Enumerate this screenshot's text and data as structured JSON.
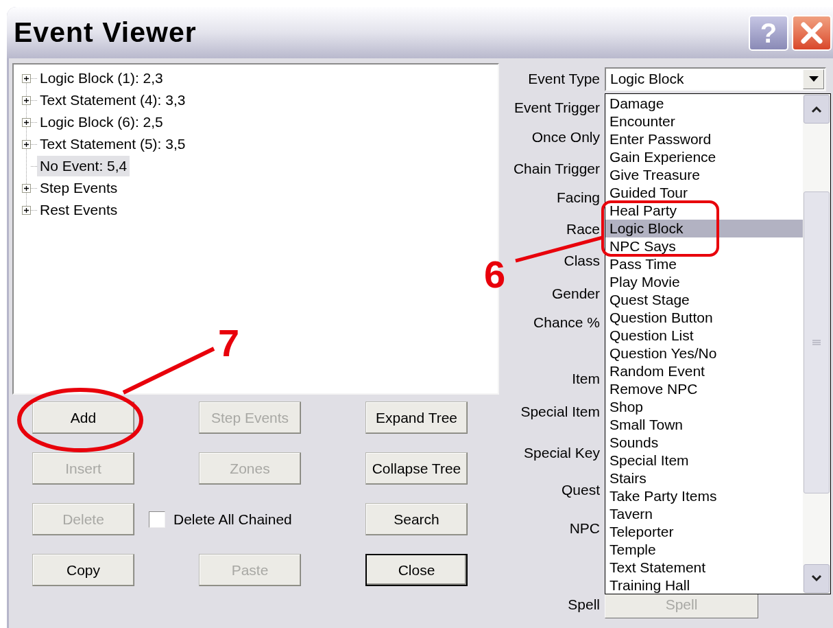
{
  "window": {
    "title": "Event Viewer"
  },
  "title_buttons": [
    {
      "kind": "help",
      "label": "?"
    },
    {
      "kind": "close"
    }
  ],
  "tree": [
    {
      "label": "Logic Block (1): 2,3",
      "expandable": true,
      "selected": false
    },
    {
      "label": "Text Statement (4): 3,3",
      "expandable": true,
      "selected": false
    },
    {
      "label": "Logic Block (6): 2,5",
      "expandable": true,
      "selected": false
    },
    {
      "label": "Text Statement (5): 3,5",
      "expandable": true,
      "selected": false
    },
    {
      "label": "No Event: 5,4",
      "expandable": false,
      "selected": true
    },
    {
      "label": "Step Events",
      "expandable": true,
      "selected": false
    },
    {
      "label": "Rest Events",
      "expandable": true,
      "selected": false
    }
  ],
  "controls": [
    {
      "kind": "button",
      "label": "Add",
      "disabled": false,
      "default": false
    },
    {
      "kind": "button",
      "label": "Step Events",
      "disabled": true,
      "default": false
    },
    {
      "kind": "button",
      "label": "Expand Tree",
      "disabled": false,
      "default": false
    },
    {
      "kind": "button",
      "label": "Insert",
      "disabled": true,
      "default": false
    },
    {
      "kind": "button",
      "label": "Zones",
      "disabled": true,
      "default": false
    },
    {
      "kind": "button",
      "label": "Collapse Tree",
      "disabled": false,
      "default": false
    },
    {
      "kind": "button",
      "label": "Delete",
      "disabled": true,
      "default": false
    },
    {
      "kind": "checkbox",
      "label": "Delete All Chained",
      "checked": false
    },
    {
      "kind": "button",
      "label": "Search",
      "disabled": false,
      "default": false
    },
    {
      "kind": "button",
      "label": "Copy",
      "disabled": false,
      "default": false
    },
    {
      "kind": "button",
      "label": "Paste",
      "disabled": true,
      "default": false
    },
    {
      "kind": "button",
      "label": "Close",
      "disabled": false,
      "default": true
    }
  ],
  "field_labels": [
    "Event Type",
    "Event Trigger",
    "Once Only",
    "Chain Trigger",
    "Facing",
    "Race",
    "Class",
    "Gender",
    "Chance %",
    "Item",
    "Special Item",
    "Special Key",
    "Quest",
    "NPC"
  ],
  "event_type": {
    "value": "Logic Block",
    "options": [
      {
        "label": "Damage",
        "selected": false
      },
      {
        "label": "Encounter",
        "selected": false
      },
      {
        "label": "Enter Password",
        "selected": false
      },
      {
        "label": "Gain Experience",
        "selected": false
      },
      {
        "label": "Give Treasure",
        "selected": false
      },
      {
        "label": "Guided Tour",
        "selected": false
      },
      {
        "label": "Heal Party",
        "selected": false
      },
      {
        "label": "Logic Block",
        "selected": true
      },
      {
        "label": "NPC Says",
        "selected": false
      },
      {
        "label": "Pass Time",
        "selected": false
      },
      {
        "label": "Play Movie",
        "selected": false
      },
      {
        "label": "Quest Stage",
        "selected": false
      },
      {
        "label": "Question Button",
        "selected": false
      },
      {
        "label": "Question List",
        "selected": false
      },
      {
        "label": "Question Yes/No",
        "selected": false
      },
      {
        "label": "Random Event",
        "selected": false
      },
      {
        "label": "Remove NPC",
        "selected": false
      },
      {
        "label": "Shop",
        "selected": false
      },
      {
        "label": "Small Town",
        "selected": false
      },
      {
        "label": "Sounds",
        "selected": false
      },
      {
        "label": "Special Item",
        "selected": false
      },
      {
        "label": "Stairs",
        "selected": false
      },
      {
        "label": "Take Party Items",
        "selected": false
      },
      {
        "label": "Tavern",
        "selected": false
      },
      {
        "label": "Teleporter",
        "selected": false
      },
      {
        "label": "Temple",
        "selected": false
      },
      {
        "label": "Text Statement",
        "selected": false
      },
      {
        "label": "Training Hall",
        "selected": false
      }
    ]
  },
  "spell": {
    "label": "Spell",
    "button": "Spell",
    "disabled": true
  },
  "annotations": [
    {
      "label": "7"
    },
    {
      "label": "6"
    }
  ]
}
